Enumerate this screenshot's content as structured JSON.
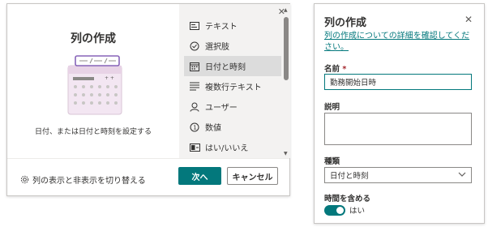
{
  "dialog": {
    "title": "列の作成",
    "close_icon": "close-icon",
    "hint": "日付、または日付と時刻を設定する",
    "types": [
      {
        "label": "テキスト",
        "icon": "text-icon"
      },
      {
        "label": "選択肢",
        "icon": "choice-icon"
      },
      {
        "label": "日付と時刻",
        "icon": "calendar-icon",
        "selected": true
      },
      {
        "label": "複数行テキスト",
        "icon": "multiline-icon"
      },
      {
        "label": "ユーザー",
        "icon": "person-icon"
      },
      {
        "label": "数値",
        "icon": "number-icon"
      },
      {
        "label": "はい/いいえ",
        "icon": "yesno-icon"
      }
    ],
    "footer": {
      "toggle_label": "列の表示と非表示を切り替える",
      "next_label": "次へ",
      "cancel_label": "キャンセル"
    }
  },
  "panel": {
    "title": "列の作成",
    "learn_link": "列の作成についての詳細を確認してください。",
    "name_label": "名前",
    "name_required_mark": "*",
    "name_value": "勤務開始日時",
    "description_label": "説明",
    "description_value": "",
    "type_label": "種類",
    "type_value": "日付と時刻",
    "include_time_label": "時間を含める",
    "include_time_value": "はい",
    "include_time_on": true
  },
  "colors": {
    "accent": "#03787c",
    "selected_bg": "#dcdcdc",
    "pane_bg": "#f3f2f1",
    "illus_purple": "#8764b8",
    "illus_pink": "#f3e6f2"
  }
}
